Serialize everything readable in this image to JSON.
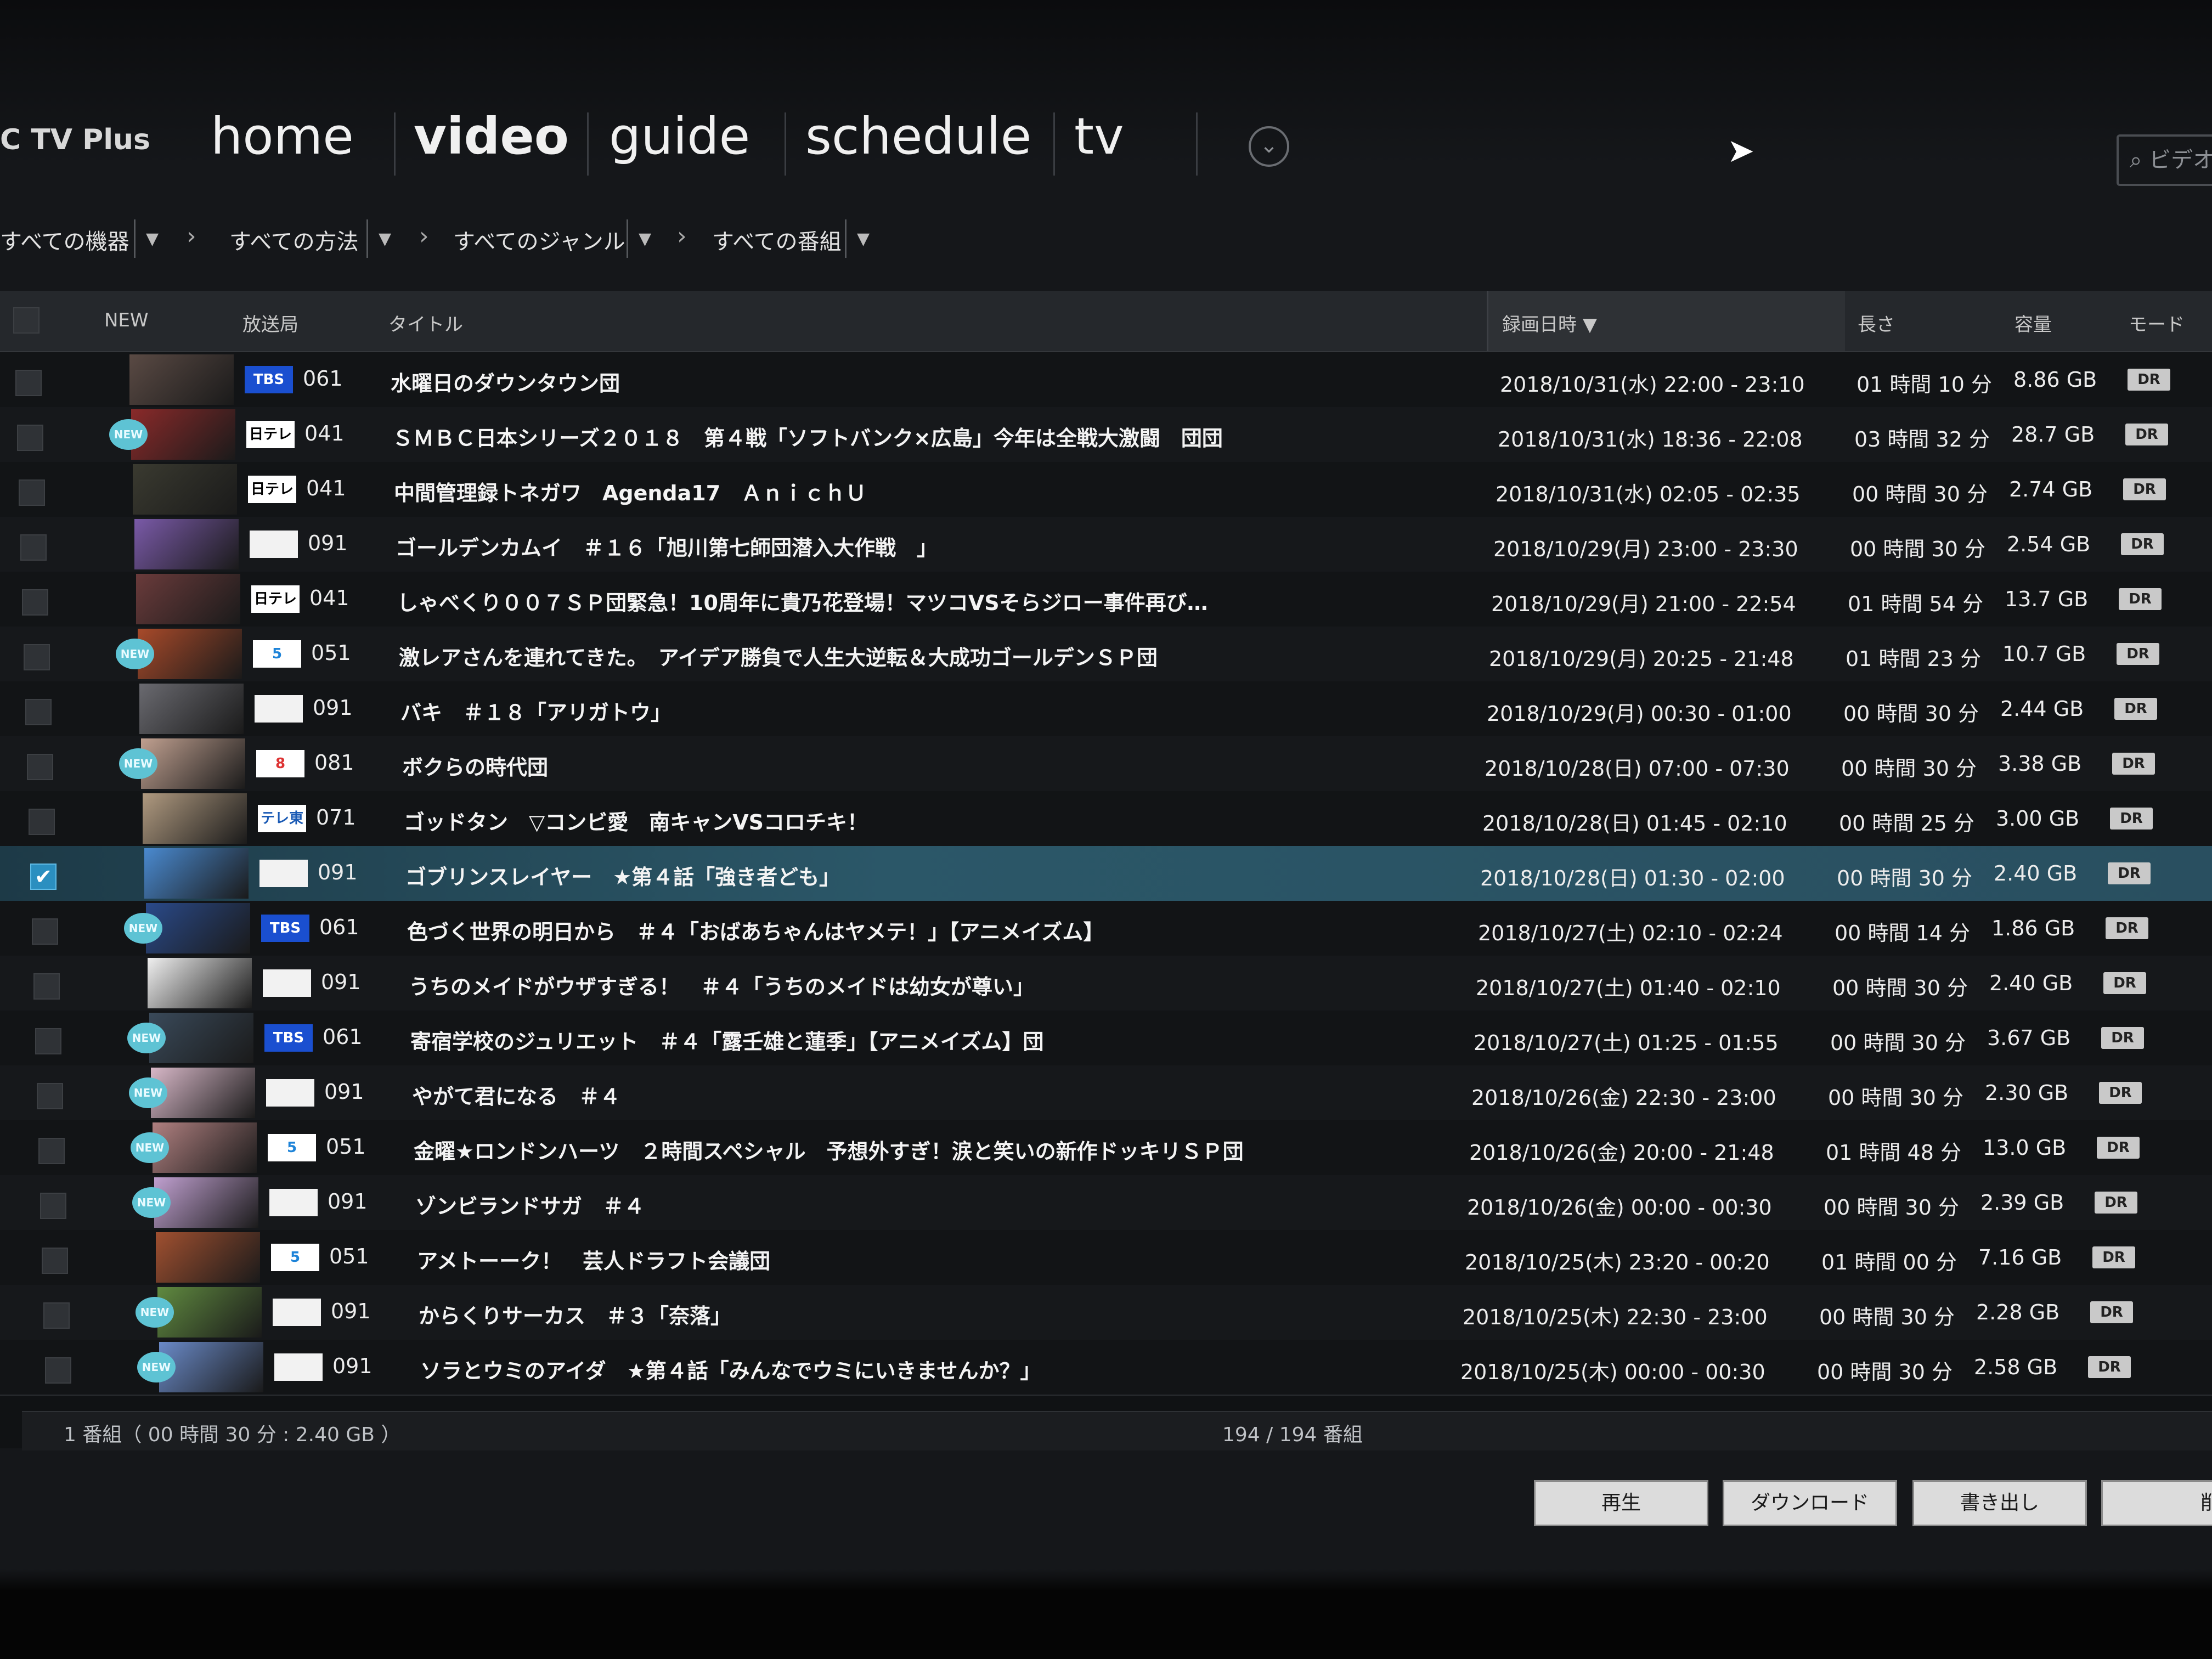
{
  "app": {
    "brand": "C TV Plus"
  },
  "nav": {
    "items": [
      "home",
      "video",
      "guide",
      "schedule",
      "tv"
    ],
    "active": "video",
    "more_icon": "chevron-down-circle-icon"
  },
  "search": {
    "placeholder": "ビデオ"
  },
  "filters": [
    "すべての機器",
    "すべての方法",
    "すべてのジャンル",
    "すべての番組"
  ],
  "table": {
    "headers": {
      "new": "NEW",
      "station": "放送局",
      "title": "タイトル",
      "date": "録画日時",
      "length": "長さ",
      "size": "容量",
      "mode": "モード"
    },
    "sort": {
      "column": "録画日時",
      "direction": "desc"
    },
    "rows": [
      {
        "new": false,
        "logo": "TBS",
        "ch": "061",
        "title": "水曜日のダウンタウン団",
        "date": "2018/10/31(水) 22:00 - 23:10",
        "length": "01 時間 10 分",
        "size": "8.86 GB",
        "mode": "DR",
        "selected": false
      },
      {
        "new": true,
        "logo": "日テレ",
        "ch": "041",
        "title": "ＳＭＢＣ日本シリーズ２０１８　第４戦「ソフトバンク×広島」今年は全戦大激闘　団団",
        "date": "2018/10/31(水) 18:36 - 22:08",
        "length": "03 時間 32 分",
        "size": "28.7 GB",
        "mode": "DR",
        "selected": false
      },
      {
        "new": false,
        "logo": "日テレ",
        "ch": "041",
        "title": "中間管理録トネガワ　Agenda17　ＡｎｉｃｈＵ",
        "date": "2018/10/31(水) 02:05 - 02:35",
        "length": "00 時間 30 分",
        "size": "2.74 GB",
        "mode": "DR",
        "selected": false
      },
      {
        "new": false,
        "logo": "",
        "ch": "091",
        "title": "ゴールデンカムイ　＃１６「旭川第七師団潜入大作戦　」",
        "date": "2018/10/29(月) 23:00 - 23:30",
        "length": "00 時間 30 分",
        "size": "2.54 GB",
        "mode": "DR",
        "selected": false
      },
      {
        "new": false,
        "logo": "日テレ",
        "ch": "041",
        "title": "しゃべくり００７ＳＰ団緊急！10周年に貴乃花登場！マツコVSそらジロー事件再び…",
        "date": "2018/10/29(月) 21:00 - 22:54",
        "length": "01 時間 54 分",
        "size": "13.7 GB",
        "mode": "DR",
        "selected": false
      },
      {
        "new": true,
        "logo": "5",
        "ch": "051",
        "title": "激レアさんを連れてきた。　アイデア勝負で人生大逆転＆大成功ゴールデンＳＰ団",
        "date": "2018/10/29(月) 20:25 - 21:48",
        "length": "01 時間 23 分",
        "size": "10.7 GB",
        "mode": "DR",
        "selected": false
      },
      {
        "new": false,
        "logo": "",
        "ch": "091",
        "title": "バキ　＃１８「アリガトウ」",
        "date": "2018/10/29(月) 00:30 - 01:00",
        "length": "00 時間 30 分",
        "size": "2.44 GB",
        "mode": "DR",
        "selected": false
      },
      {
        "new": true,
        "logo": "8",
        "ch": "081",
        "title": "ボクらの時代団",
        "date": "2018/10/28(日) 07:00 - 07:30",
        "length": "00 時間 30 分",
        "size": "3.38 GB",
        "mode": "DR",
        "selected": false
      },
      {
        "new": false,
        "logo": "テレ東",
        "ch": "071",
        "title": "ゴッドタン　▽コンビ愛　南キャンVSコロチキ！",
        "date": "2018/10/28(日) 01:45 - 02:10",
        "length": "00 時間 25 分",
        "size": "3.00 GB",
        "mode": "DR",
        "selected": false
      },
      {
        "new": false,
        "logo": "",
        "ch": "091",
        "title": "ゴブリンスレイヤー　★第４話「強き者ども」",
        "date": "2018/10/28(日) 01:30 - 02:00",
        "length": "00 時間 30 分",
        "size": "2.40 GB",
        "mode": "DR",
        "selected": true
      },
      {
        "new": true,
        "logo": "TBS",
        "ch": "061",
        "title": "色づく世界の明日から　＃４「おばあちゃんはヤメテ！」【アニメイズム】",
        "date": "2018/10/27(土) 02:10 - 02:24",
        "length": "00 時間 14 分",
        "size": "1.86 GB",
        "mode": "DR",
        "selected": false
      },
      {
        "new": false,
        "logo": "",
        "ch": "091",
        "title": "うちのメイドがウザすぎる！　＃４「うちのメイドは幼女が尊い」",
        "date": "2018/10/27(土) 01:40 - 02:10",
        "length": "00 時間 30 分",
        "size": "2.40 GB",
        "mode": "DR",
        "selected": false
      },
      {
        "new": true,
        "logo": "TBS",
        "ch": "061",
        "title": "寄宿学校のジュリエット　＃４「露壬雄と蓮季」【アニメイズム】団",
        "date": "2018/10/27(土) 01:25 - 01:55",
        "length": "00 時間 30 分",
        "size": "3.67 GB",
        "mode": "DR",
        "selected": false
      },
      {
        "new": true,
        "logo": "",
        "ch": "091",
        "title": "やがて君になる　＃４",
        "date": "2018/10/26(金) 22:30 - 23:00",
        "length": "00 時間 30 分",
        "size": "2.30 GB",
        "mode": "DR",
        "selected": false
      },
      {
        "new": true,
        "logo": "5",
        "ch": "051",
        "title": "金曜★ロンドンハーツ　２時間スペシャル　予想外すぎ！涙と笑いの新作ドッキリＳＰ団",
        "date": "2018/10/26(金) 20:00 - 21:48",
        "length": "01 時間 48 分",
        "size": "13.0 GB",
        "mode": "DR",
        "selected": false
      },
      {
        "new": true,
        "logo": "",
        "ch": "091",
        "title": "ゾンビランドサガ　＃４",
        "date": "2018/10/26(金) 00:00 - 00:30",
        "length": "00 時間 30 分",
        "size": "2.39 GB",
        "mode": "DR",
        "selected": false
      },
      {
        "new": false,
        "logo": "5",
        "ch": "051",
        "title": "アメトーーク！　芸人ドラフト会議団",
        "date": "2018/10/25(木) 23:20 - 00:20",
        "length": "01 時間 00 分",
        "size": "7.16 GB",
        "mode": "DR",
        "selected": false
      },
      {
        "new": true,
        "logo": "",
        "ch": "091",
        "title": "からくりサーカス　＃３「奈落」",
        "date": "2018/10/25(木) 22:30 - 23:00",
        "length": "00 時間 30 分",
        "size": "2.28 GB",
        "mode": "DR",
        "selected": false
      },
      {
        "new": true,
        "logo": "",
        "ch": "091",
        "title": "ソラとウミのアイダ　★第４話「みんなでウミにいきませんか？」",
        "date": "2018/10/25(木) 00:00 - 00:30",
        "length": "00 時間 30 分",
        "size": "2.58 GB",
        "mode": "DR",
        "selected": false
      }
    ]
  },
  "footer": {
    "selection_summary": "1 番組（ 00 時間 30 分 : 2.40 GB ）",
    "count": "194 / 194 番組"
  },
  "actions": [
    "再生",
    "ダウンロード",
    "書き出し",
    "削除"
  ],
  "new_badge": "NEW",
  "colors": {
    "accent": "#2b8fc0",
    "new_badge": "#5ec3d4",
    "selected_row": "#2b5768",
    "tbs_logo": "#1a4fd0"
  }
}
